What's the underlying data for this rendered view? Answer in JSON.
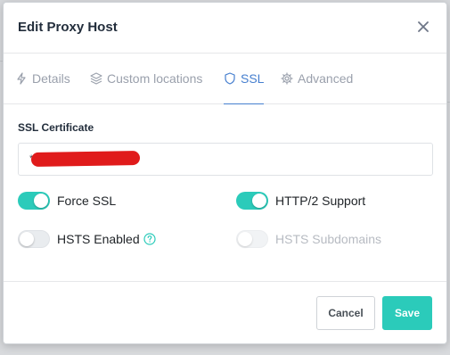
{
  "modal": {
    "title": "Edit Proxy Host"
  },
  "tabs": [
    {
      "label": "Details",
      "icon": "lightning-icon"
    },
    {
      "label": "Custom locations",
      "icon": "layers-icon"
    },
    {
      "label": "SSL",
      "icon": "shield-icon",
      "active": true
    },
    {
      "label": "Advanced",
      "icon": "gear-icon"
    }
  ],
  "ssl": {
    "certificate_label": "SSL Certificate",
    "certificate_value_prefix": "*",
    "force_ssl": {
      "label": "Force SSL",
      "enabled": true
    },
    "http2": {
      "label": "HTTP/2 Support",
      "enabled": true
    },
    "hsts": {
      "label": "HSTS Enabled",
      "enabled": false
    },
    "hsts_subdomains": {
      "label": "HSTS Subdomains",
      "enabled": false,
      "disabled": true
    }
  },
  "footer": {
    "cancel_label": "Cancel",
    "save_label": "Save"
  },
  "colors": {
    "accent": "#467fcf",
    "toggle_on": "#2bcbba",
    "save_button": "#2bcbba",
    "redaction": "#e01b1b"
  }
}
